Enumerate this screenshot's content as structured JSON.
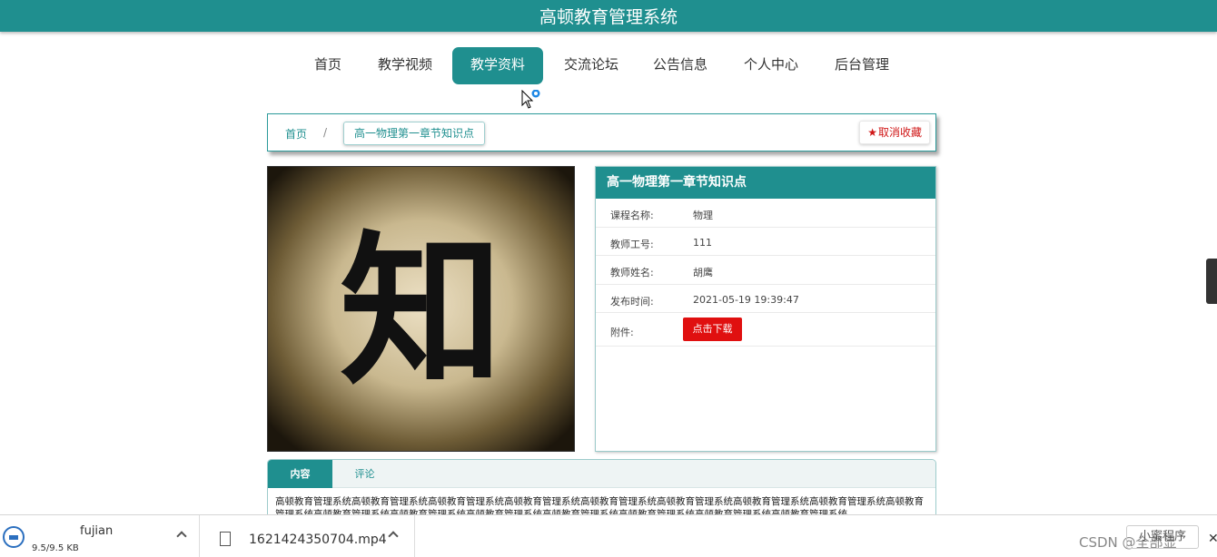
{
  "header": {
    "title": "高顿教育管理系统"
  },
  "nav": {
    "items": [
      "首页",
      "教学视频",
      "教学资料",
      "交流论坛",
      "公告信息",
      "个人中心",
      "后台管理"
    ],
    "active_index": 2
  },
  "breadcrumb": {
    "home": "首页",
    "separator": "/",
    "current": "高一物理第一章节知识点"
  },
  "favorite": {
    "label": "取消收藏",
    "icon": "star-icon"
  },
  "cover": {
    "glyph": "知"
  },
  "info": {
    "title": "高一物理第一章节知识点",
    "rows": [
      {
        "key": "课程名称:",
        "value": "物理"
      },
      {
        "key": "教师工号:",
        "value": "111"
      },
      {
        "key": "教师姓名:",
        "value": "胡鹰"
      },
      {
        "key": "发布时间:",
        "value": "2021-05-19 19:39:47"
      }
    ],
    "attachment_key": "附件:",
    "download_label": "点击下载"
  },
  "tabs": {
    "items": [
      "内容",
      "评论"
    ],
    "content": "高顿教育管理系统高顿教育管理系统高顿教育管理系统高顿教育管理系统高顿教育管理系统高顿教育管理系统高顿教育管理系统高顿教育管理系统高顿教育管理系统高顿教育管理系统高顿教育管理系统高顿教育管理系统高顿教育管理系统高顿教育管理系统高顿教育管理系统高顿教育管理系统"
  },
  "downloads": {
    "item1": {
      "name": "fujian",
      "size": "9.5/9.5 KB"
    },
    "item2": {
      "name": "1621424350704.mp4"
    },
    "watermark": "CSDN @全部显",
    "show_all": "小蜜程序"
  },
  "colors": {
    "primary": "#1f8f8f",
    "danger": "#e01010"
  }
}
